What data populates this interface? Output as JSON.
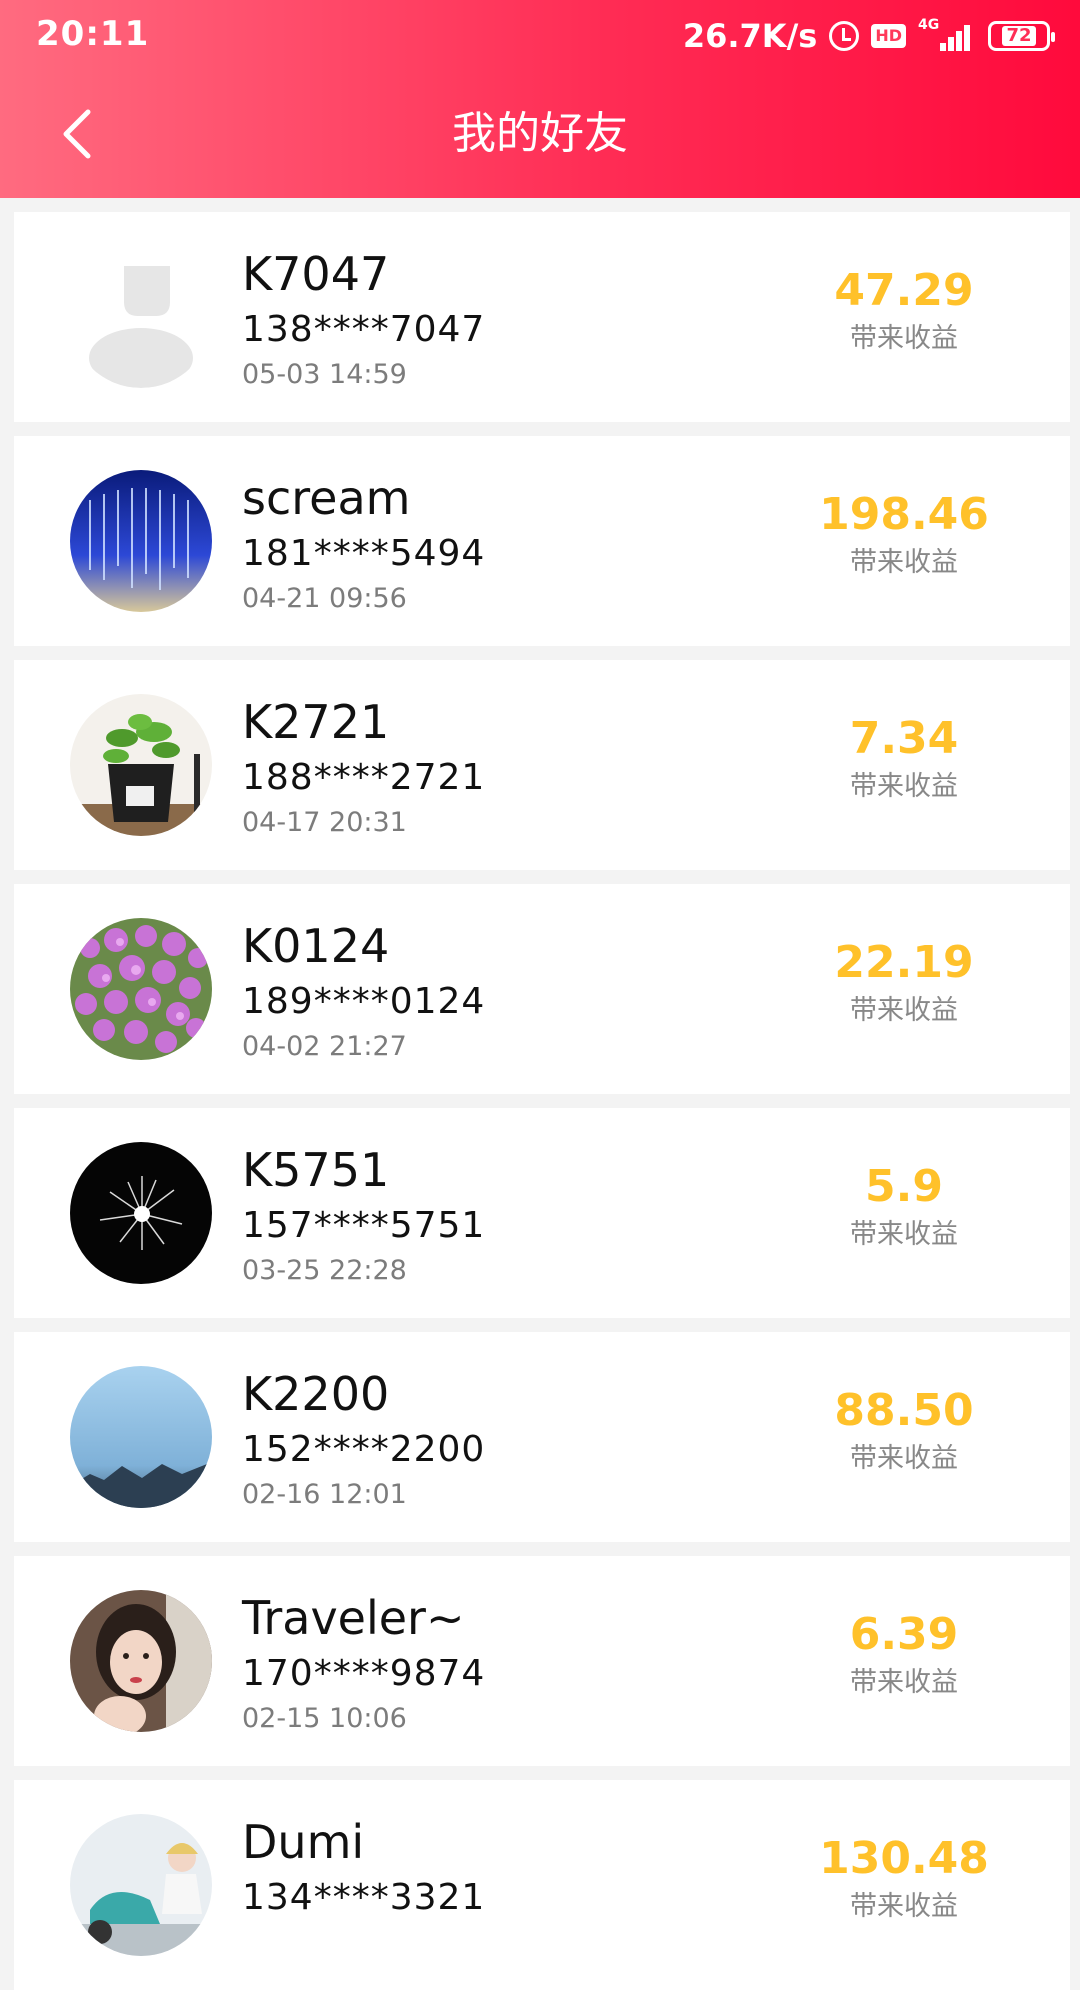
{
  "status_bar": {
    "time": "20:11",
    "speed": "26.7K/s",
    "hd": "HD",
    "network": "4G",
    "battery": "72",
    "icons": [
      "alarm-icon",
      "hd-icon",
      "signal-icon",
      "battery-icon"
    ]
  },
  "header": {
    "title": "我的好友",
    "back_icon": "chevron-left-icon"
  },
  "colors": {
    "header_start": "#ff6b80",
    "header_end": "#ff0a3c",
    "amount": "#ffc12a"
  },
  "friends": [
    {
      "name": "K7047",
      "phone": "138****7047",
      "date": "05-03 14:59",
      "amount": "47.29",
      "amount_label": "带来收益",
      "avatar": "default-user-icon"
    },
    {
      "name": "scream",
      "phone": "181****5494",
      "date": "04-21 09:56",
      "amount": "198.46",
      "amount_label": "带来收益",
      "avatar": "light-installation-photo"
    },
    {
      "name": "K2721",
      "phone": "188****2721",
      "date": "04-17 20:31",
      "amount": "7.34",
      "amount_label": "带来收益",
      "avatar": "potted-plant-photo"
    },
    {
      "name": "K0124",
      "phone": "189****0124",
      "date": "04-02 21:27",
      "amount": "22.19",
      "amount_label": "带来收益",
      "avatar": "purple-flowers-photo"
    },
    {
      "name": "K5751",
      "phone": "157****5751",
      "date": "03-25 22:28",
      "amount": "5.9",
      "amount_label": "带来收益",
      "avatar": "firework-photo"
    },
    {
      "name": "K2200",
      "phone": "152****2200",
      "date": "02-16 12:01",
      "amount": "88.50",
      "amount_label": "带来收益",
      "avatar": "misty-sky-photo"
    },
    {
      "name": "Traveler~",
      "phone": "170****9874",
      "date": "02-15 10:06",
      "amount": "6.39",
      "amount_label": "带来收益",
      "avatar": "portrait-photo"
    },
    {
      "name": "Dumi",
      "phone": "134****3321",
      "date": "",
      "amount": "130.48",
      "amount_label": "带来收益",
      "avatar": "scooter-photo"
    }
  ]
}
